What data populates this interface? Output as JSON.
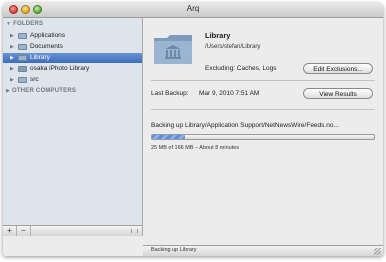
{
  "window": {
    "title": "Arq"
  },
  "sidebar": {
    "sections": [
      {
        "label": "FOLDERS"
      },
      {
        "label": "OTHER COMPUTERS"
      }
    ],
    "items": [
      {
        "label": "Applications",
        "selected": false,
        "icon": "folder-icon"
      },
      {
        "label": "Documents",
        "selected": false,
        "icon": "folder-icon"
      },
      {
        "label": "Library",
        "selected": true,
        "icon": "folder-icon"
      },
      {
        "label": "osaka iPhoto Library",
        "selected": false,
        "icon": "folder-icon"
      },
      {
        "label": "src",
        "selected": false,
        "icon": "folder-icon"
      }
    ],
    "add_label": "+",
    "remove_label": "−"
  },
  "detail": {
    "title": "Library",
    "path": "/Users/stefan/Library",
    "exclusions": "Excluding: Caches, Logs",
    "edit_exclusions_label": "Edit Exclusions...",
    "last_backup_label": "Last Backup:",
    "last_backup_value": "Mar 9, 2010 7:51 AM",
    "view_results_label": "View Results",
    "status": "Backing up Library/Application Support/NetNewsWire/Feeds.no...",
    "progress_fraction": 0.15,
    "progress_detail": "25 MB of 166 MB – About 8 minutes"
  },
  "footer": {
    "status": "Backing up Library"
  },
  "colors": {
    "selection": "#3c6cba",
    "sidebar_bg": "#dde4ec",
    "progress": "#5b8fd8"
  }
}
